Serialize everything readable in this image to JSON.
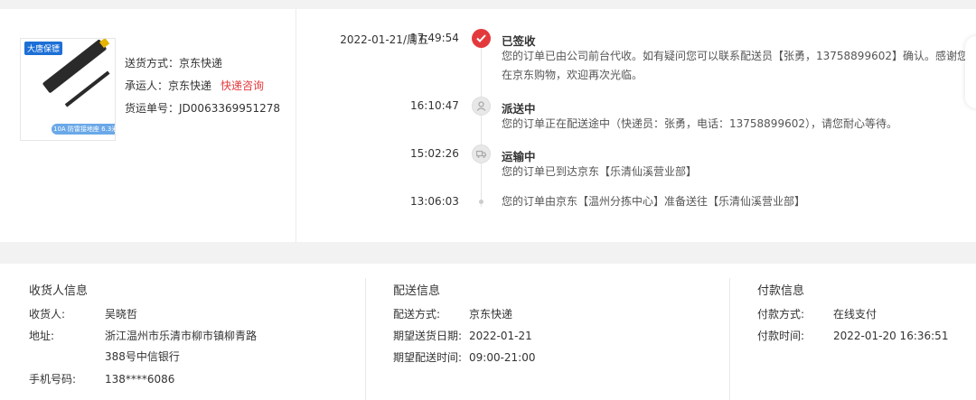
{
  "shipment": {
    "method_label": "送货方式：",
    "method": "京东快递",
    "carrier_label": "承运人：",
    "carrier": "京东快递",
    "carrier_link": "快递咨询",
    "tracking_label": "货运单号：",
    "tracking": "JD0063369951278",
    "thumb_brand": "大唐保镖",
    "thumb_caption": "10A 防雷接地座 6.3米"
  },
  "timeline": [
    {
      "date": "2022-01-21/周五",
      "time": "17:49:54",
      "title": "已签收",
      "icon": "check-icon",
      "desc": "您的订单已由公司前台代收。如有疑问您可以联系配送员【张勇，13758899602】确认。感谢您在京东购物，欢迎再次光临。"
    },
    {
      "date": "",
      "time": "16:10:47",
      "title": "派送中",
      "icon": "delivery-person-icon",
      "desc": "您的订单正在配送途中（快递员：张勇，电话：13758899602），请您耐心等待。"
    },
    {
      "date": "",
      "time": "15:02:26",
      "title": "运输中",
      "icon": "truck-icon",
      "desc": "您的订单已到达京东【乐清仙溪营业部】"
    },
    {
      "date": "",
      "time": "13:06:03",
      "title": "",
      "icon": "dot",
      "desc": "您的订单由京东【温州分拣中心】准备送往【乐清仙溪营业部】"
    }
  ],
  "receiver": {
    "heading": "收货人信息",
    "name_label": "收货人:",
    "name": "吴晓哲",
    "address_label": "地址:",
    "address_line1": "浙江温州市乐清市柳市镇柳青路",
    "address_line2": "388号中信银行",
    "phone_label": "手机号码:",
    "phone": "138****6086"
  },
  "delivery": {
    "heading": "配送信息",
    "method_label": "配送方式:",
    "method": "京东快递",
    "date_label": "期望送货日期:",
    "date": "2022-01-21",
    "time_label": "期望配送时间:",
    "time": "09:00-21:00"
  },
  "payment": {
    "heading": "付款信息",
    "method_label": "付款方式:",
    "method": "在线支付",
    "time_label": "付款时间:",
    "time": "2022-01-20 16:36:51"
  },
  "colors": {
    "accent": "#e4393c",
    "background": "#f2f2f2"
  }
}
